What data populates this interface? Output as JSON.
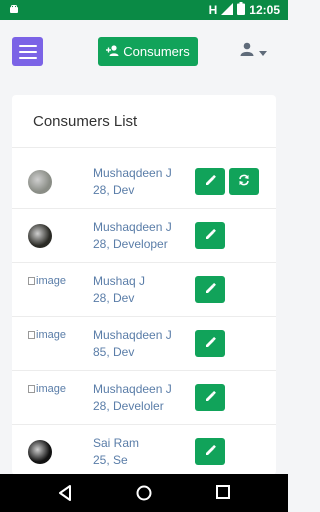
{
  "status_bar": {
    "network_letter": "H",
    "time": "12:05",
    "icons": [
      "android-notification-icon",
      "signal-icon",
      "battery-icon"
    ]
  },
  "header": {
    "consumers_label": "Consumers",
    "icons": [
      "menu-icon",
      "add-user-icon",
      "user-icon",
      "caret-down-icon"
    ]
  },
  "card": {
    "title": "Consumers List"
  },
  "consumers": [
    {
      "name": "Mushaqdeen J",
      "detail": "28, Dev",
      "image_alt": "",
      "avatar_color": "#8a8d86",
      "has_refresh": true
    },
    {
      "name": "Mushaqdeen J",
      "detail": "28, Developer",
      "image_alt": "",
      "avatar_color": "#2a2a25",
      "has_refresh": false
    },
    {
      "name": "Mushaq J",
      "detail": "28, Dev",
      "image_alt": "image",
      "has_refresh": false
    },
    {
      "name": "Mushaqdeen J",
      "detail": "85, Dev",
      "image_alt": "image",
      "has_refresh": false
    },
    {
      "name": "Mushaqdeen J",
      "detail": "28, Develoler",
      "image_alt": "image",
      "has_refresh": false
    },
    {
      "name": "Sai Ram",
      "detail": "25, Se",
      "image_alt": "",
      "avatar_color": "#111111",
      "has_refresh": false
    }
  ],
  "colors": {
    "status_bar": "#0a8a45",
    "primary_green": "#11a35a",
    "menu_purple": "#7b63e6",
    "text_blue": "#5a7da8"
  },
  "nav_bar": {
    "icons": [
      "back-icon",
      "home-icon",
      "recents-icon"
    ]
  }
}
